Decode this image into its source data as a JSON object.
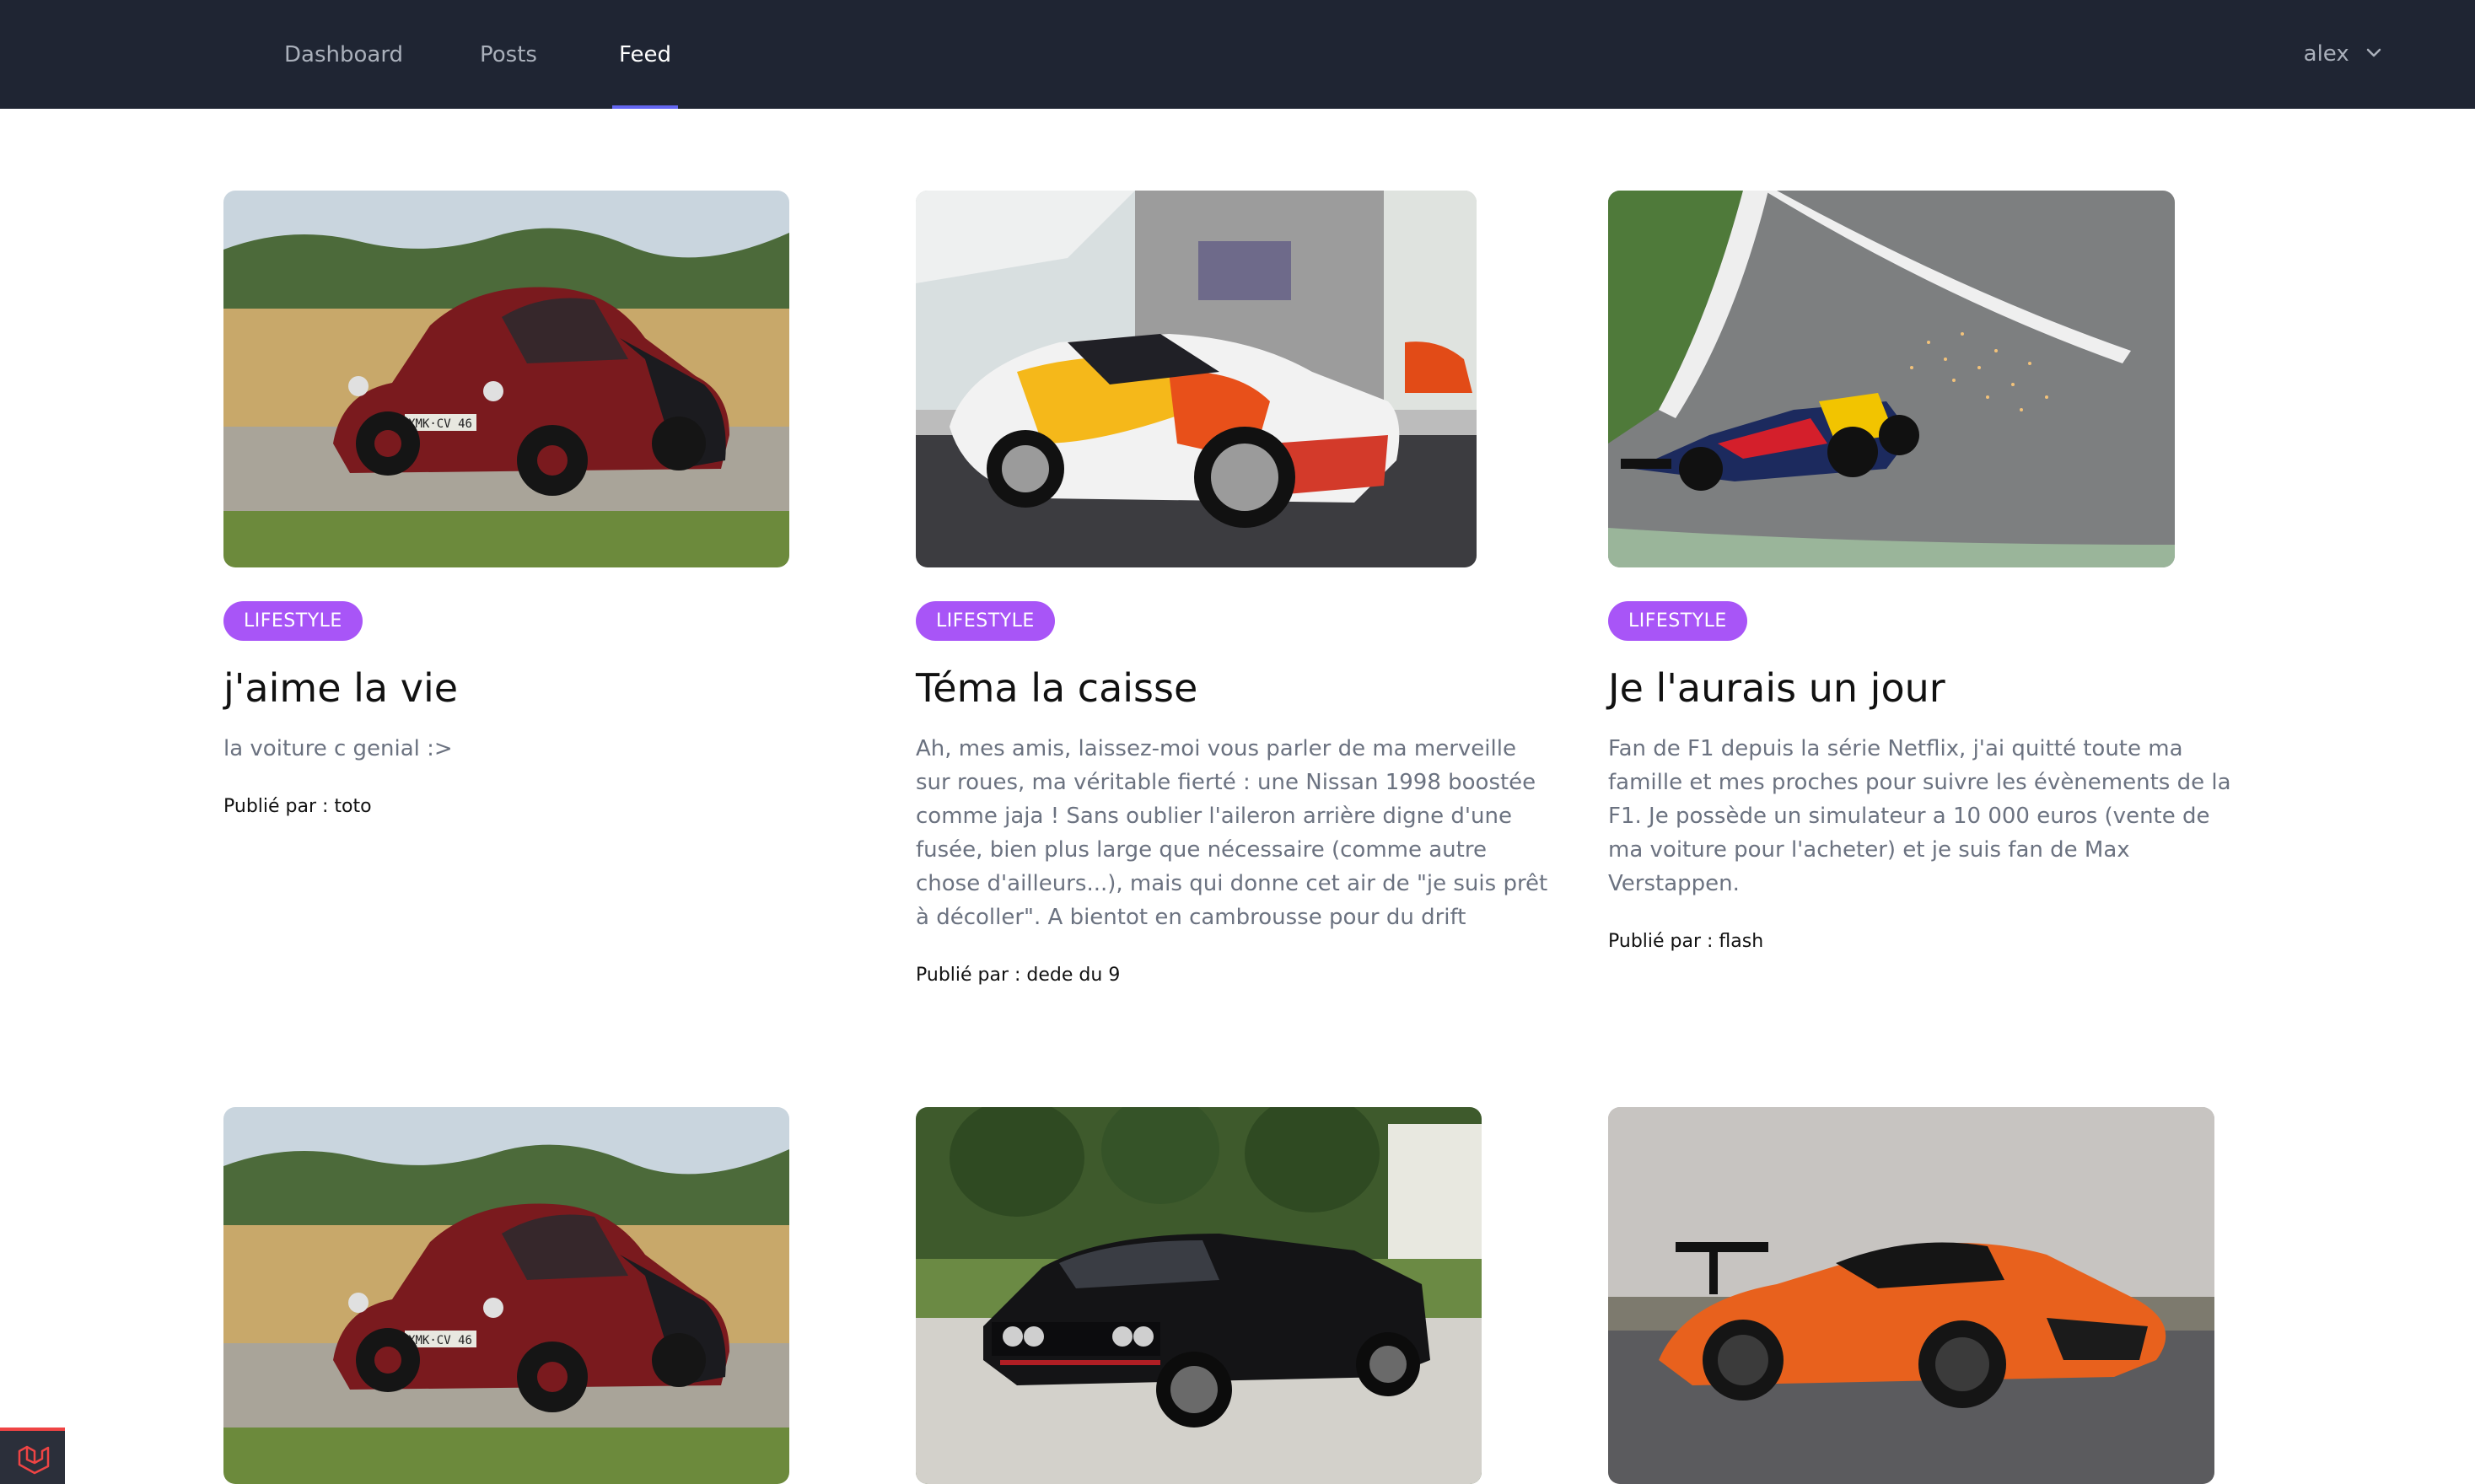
{
  "nav": {
    "links": [
      {
        "label": "Dashboard"
      },
      {
        "label": "Posts"
      },
      {
        "label": "Feed"
      }
    ],
    "active": "Feed",
    "user": {
      "name": "alex"
    }
  },
  "colors": {
    "nav_bg": "#1f2533",
    "active_underline": "#6366f1",
    "badge_bg": "#a855f7",
    "corner_accent": "#ef4444"
  },
  "posts": [
    {
      "category": "LIFESTYLE",
      "title": "j'aime la vie",
      "excerpt": "la voiture c genial :>",
      "author": "Publié par : toto"
    },
    {
      "category": "LIFESTYLE",
      "title": "Téma la caisse",
      "excerpt": "Ah, mes amis, laissez-moi vous parler de ma merveille sur roues, ma véritable fierté : une Nissan 1998 boostée comme jaja ! Sans oublier l'aileron arrière digne d'une fusée, bien plus large que nécessaire (comme autre chose d'ailleurs...), mais qui donne cet air de \"je suis prêt à décoller\". A bientot en cambrousse pour du drift",
      "author": "Publié par : dede du 9"
    },
    {
      "category": "LIFESTYLE",
      "title": "Je l'aurais un jour",
      "excerpt": "Fan de F1 depuis la série Netflix, j'ai quitté toute ma famille et mes proches pour suivre les évènements de la F1. Je possède un simulateur a 10 000 euros (vente de ma voiture pour l'acheter) et je suis fan de Max Verstappen.",
      "author": "Publié par : flash"
    }
  ],
  "plate_text": "XMK·CV 46"
}
